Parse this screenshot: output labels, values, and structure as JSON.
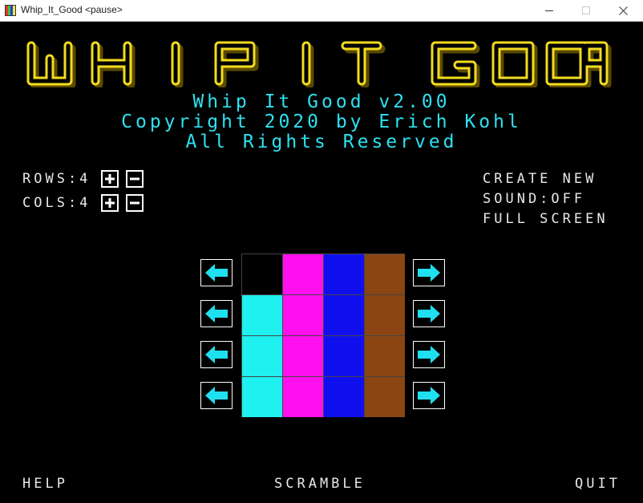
{
  "window": {
    "title": "Whip_It_Good <pause>",
    "minimize_icon": "minimize-icon",
    "maximize_icon": "maximize-icon",
    "close_icon": "close-icon"
  },
  "logo": {
    "text": "WHIP IT GOOD",
    "color": "#f2dc1e"
  },
  "header": {
    "line1": "Whip It Good v2.00",
    "line2": "Copyright 2020 by Erich Kohl",
    "line3": "All Rights Reserved",
    "color": "#2de1f0"
  },
  "settings": {
    "rows_label": "ROWS:4",
    "cols_label": "COLS:4",
    "plus_icon": "plus-icon",
    "minus_icon": "minus-icon"
  },
  "menu": {
    "create_new": "CREATE NEW",
    "sound": "SOUND:OFF",
    "full_screen": "FULL SCREEN"
  },
  "board": {
    "rows": 4,
    "cols": 4,
    "colors": {
      "K": "#000000",
      "C": "#1ff0f0",
      "M": "#ff10ee",
      "B": "#1010ee",
      "R": "#8b4513"
    },
    "tiles": [
      [
        "K",
        "M",
        "B",
        "R"
      ],
      [
        "C",
        "M",
        "B",
        "R"
      ],
      [
        "C",
        "M",
        "B",
        "R"
      ],
      [
        "C",
        "M",
        "B",
        "R"
      ]
    ],
    "arrow_color": "#1fe0f0",
    "left_arrow_icon": "arrow-left-icon",
    "right_arrow_icon": "arrow-right-icon"
  },
  "footer": {
    "help": "HELP",
    "scramble": "SCRAMBLE",
    "quit": "QUIT"
  }
}
